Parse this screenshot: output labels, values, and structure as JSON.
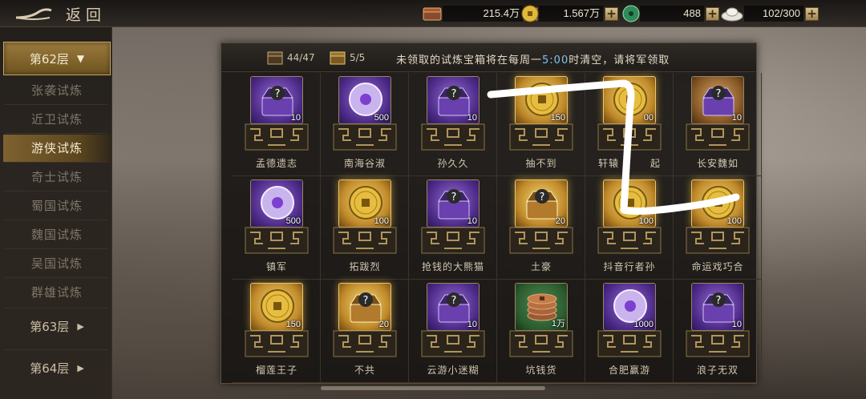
{
  "topbar": {
    "back_label": "返回",
    "resources": [
      {
        "icon": "chest-resource-icon",
        "value": "215.4万"
      },
      {
        "icon": "gold-coin-icon",
        "value": "1.567万"
      },
      {
        "icon": "jade-coin-icon",
        "value": "488"
      },
      {
        "icon": "silver-ingot-icon",
        "value": "102/300"
      }
    ],
    "plus_label": "+"
  },
  "sidebar": {
    "floor_62": "第62层",
    "items": [
      "张袭试炼",
      "近卫试炼",
      "游侠试炼",
      "奇士试炼",
      "蜀国试炼",
      "魏国试炼",
      "吴国试炼",
      "群雄试炼"
    ],
    "active_item": "游侠试炼",
    "floor_63": "第63层",
    "floor_64": "第64层"
  },
  "panel": {
    "count_1": "44/47",
    "count_2": "5/5",
    "notice_pre": "未领取的试炼宝箱将在每周一",
    "notice_time": "5:00",
    "notice_post": "时清空，请将军领取",
    "rewards": [
      {
        "name": "孟德遗志",
        "type": "chest",
        "card": "purple",
        "qty": "10"
      },
      {
        "name": "南海谷淑",
        "type": "jade",
        "card": "purple",
        "qty": "500"
      },
      {
        "name": "孙久久",
        "type": "chest",
        "card": "purple",
        "qty": "10"
      },
      {
        "name": "抽不到",
        "type": "coin",
        "card": "gold",
        "qty": "150"
      },
      {
        "name": "轩辕　　　起",
        "type": "coin",
        "card": "gold",
        "qty": "00"
      },
      {
        "name": "长安魏如",
        "type": "chest",
        "card": "bronze",
        "qty": "10"
      },
      {
        "name": "镇军",
        "type": "jade",
        "card": "purple",
        "qty": "500"
      },
      {
        "name": "拓跋烈",
        "type": "coin",
        "card": "gold",
        "qty": "100"
      },
      {
        "name": "抢钱的大熊猫",
        "type": "chest",
        "card": "purple",
        "qty": "10"
      },
      {
        "name": "土豪",
        "type": "goldchest",
        "card": "gold",
        "qty": "20"
      },
      {
        "name": "抖音行者孙",
        "type": "coin",
        "card": "gold",
        "qty": "100"
      },
      {
        "name": "命运戏巧合",
        "type": "coin",
        "card": "gold",
        "qty": "100"
      },
      {
        "name": "榴莲王子",
        "type": "coin",
        "card": "gold",
        "qty": "150"
      },
      {
        "name": "不共",
        "type": "goldchest",
        "card": "gold",
        "qty": "20"
      },
      {
        "name": "云游小迷糊",
        "type": "chest",
        "card": "purple",
        "qty": "10"
      },
      {
        "name": "坑钱货",
        "type": "copper",
        "card": "green",
        "qty": "1万"
      },
      {
        "name": "合肥赢游",
        "type": "jade",
        "card": "purple",
        "qty": "1000"
      },
      {
        "name": "浪子无双",
        "type": "chest",
        "card": "purple",
        "qty": "10"
      }
    ]
  },
  "colors": {
    "accent_gold": "#c9a866",
    "highlight_blue": "#7ec3f0",
    "scribble": "#ffffff"
  }
}
